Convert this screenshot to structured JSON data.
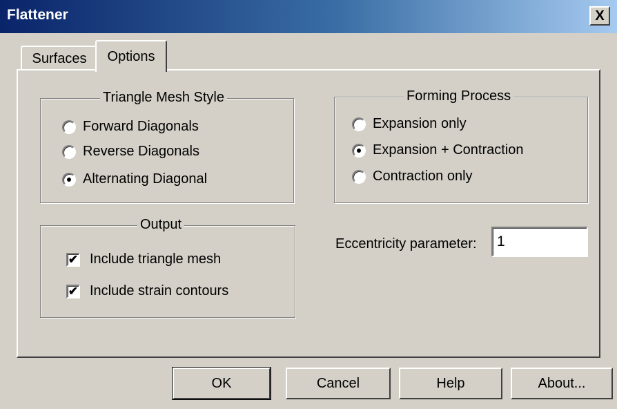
{
  "window": {
    "title": "Flattener",
    "close_label": "X"
  },
  "tabs": [
    {
      "label": "Surfaces",
      "active": false
    },
    {
      "label": "Options",
      "active": true
    }
  ],
  "triangle_mesh_style": {
    "title": "Triangle Mesh Style",
    "options": [
      {
        "label": "Forward Diagonals",
        "selected": false
      },
      {
        "label": "Reverse Diagonals",
        "selected": false
      },
      {
        "label": "Alternating Diagonal",
        "selected": true
      }
    ]
  },
  "forming_process": {
    "title": "Forming Process",
    "options": [
      {
        "label": "Expansion only",
        "selected": false
      },
      {
        "label": "Expansion + Contraction",
        "selected": true
      },
      {
        "label": "Contraction only",
        "selected": false
      }
    ]
  },
  "output": {
    "title": "Output",
    "options": [
      {
        "label": "Include triangle mesh",
        "checked": true
      },
      {
        "label": "Include strain contours",
        "checked": true
      }
    ]
  },
  "eccentricity": {
    "label": "Eccentricity parameter:",
    "value": "1"
  },
  "buttons": {
    "ok": "OK",
    "cancel": "Cancel",
    "help": "Help",
    "about": "About..."
  }
}
